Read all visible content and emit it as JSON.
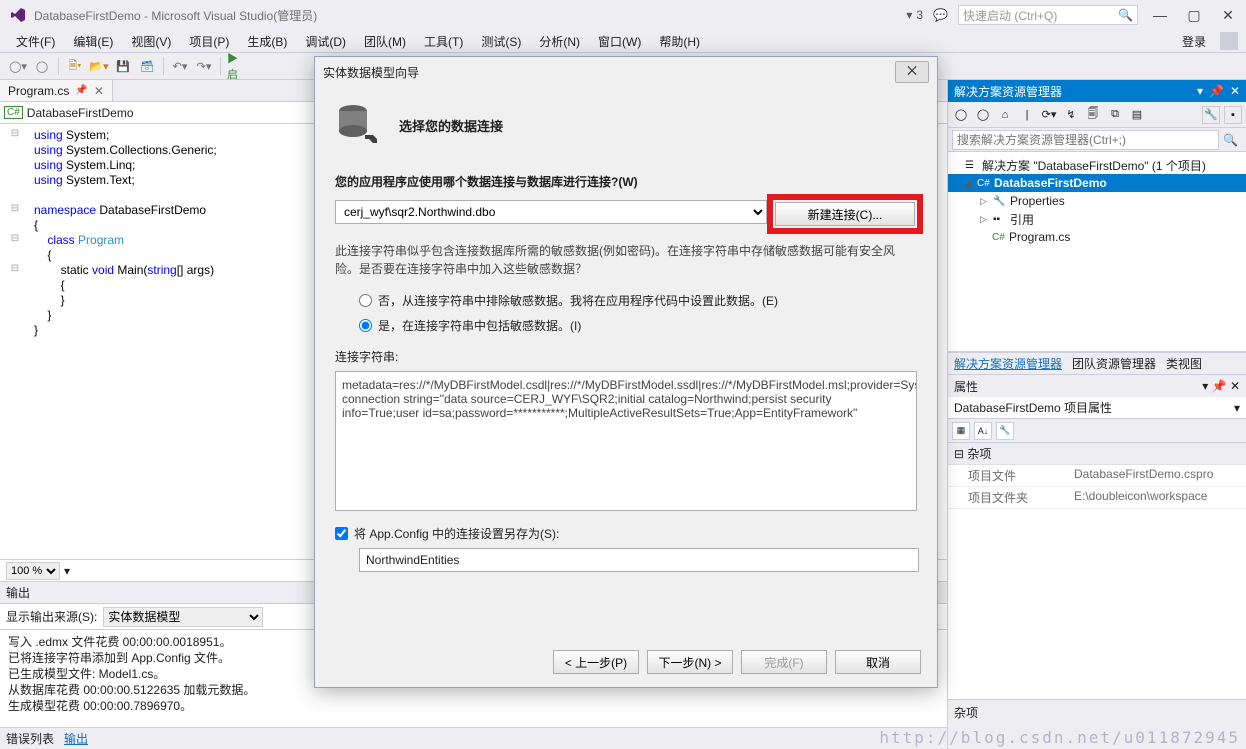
{
  "titlebar": {
    "title": "DatabaseFirstDemo - Microsoft Visual Studio(管理员)",
    "notif_count": "3",
    "search_placeholder": "快速启动 (Ctrl+Q)"
  },
  "menu": {
    "items": [
      "文件(F)",
      "编辑(E)",
      "视图(V)",
      "项目(P)",
      "生成(B)",
      "调试(D)",
      "团队(M)",
      "工具(T)",
      "测试(S)",
      "分析(N)",
      "窗口(W)",
      "帮助(H)"
    ],
    "login": "登录"
  },
  "doc_tab": {
    "name": "Program.cs"
  },
  "crumb": {
    "ns": "DatabaseFirstDemo"
  },
  "code": {
    "l1a": "using",
    "l1b": " System;",
    "l2a": "using",
    "l2b": " System.Collections.Generic;",
    "l3a": "using",
    "l3b": " System.Linq;",
    "l4a": "using",
    "l4b": " System.Text;",
    "l5a": "namespace",
    "l5b": " DatabaseFirstDemo",
    "l6": "{",
    "l7a": "    class",
    "l7b": " Program",
    "l8": "    {",
    "l9a": "        static ",
    "l9b": "void",
    "l9c": " Main(",
    "l9d": "string",
    "l9e": "[] args)",
    "l10": "        {",
    "l11": "        }",
    "l12": "    }",
    "l13": "}"
  },
  "zoom": "100 %",
  "output": {
    "title": "输出",
    "src_label": "显示输出来源(S):",
    "src_value": "实体数据模型",
    "lines": [
      "写入 .edmx 文件花费 00:00:00.0018951。",
      "已将连接字符串添加到 App.Config 文件。",
      "已生成模型文件: Model1.cs。",
      "从数据库花费 00:00:00.5122635 加载元数据。",
      "生成模型花费 00:00:00.7896970。"
    ],
    "tabs": [
      "错误列表",
      "输出"
    ]
  },
  "se": {
    "title": "解决方案资源管理器",
    "search_ph": "搜索解决方案资源管理器(Ctrl+;)",
    "sol": "解决方案 \"DatabaseFirstDemo\" (1 个项目)",
    "proj": "DatabaseFirstDemo",
    "nodes": [
      "Properties",
      "引用",
      "Program.cs"
    ],
    "bot_tabs": [
      "解决方案资源管理器",
      "团队资源管理器",
      "类视图"
    ]
  },
  "props": {
    "title": "属性",
    "obj": "DatabaseFirstDemo 项目属性",
    "cat": "杂项",
    "rows": [
      {
        "k": "项目文件",
        "v": "DatabaseFirstDemo.cspro"
      },
      {
        "k": "项目文件夹",
        "v": "E:\\doubleicon\\workspace"
      }
    ],
    "desc": "杂项"
  },
  "dialog": {
    "title": "实体数据模型向导",
    "heading": "选择您的数据连接",
    "q": "您的应用程序应使用哪个数据连接与数据库进行连接?(W)",
    "conn": "cerj_wyf\\sqr2.Northwind.dbo",
    "new_conn": "新建连接(C)...",
    "sensitive": "此连接字符串似乎包含连接数据库所需的敏感数据(例如密码)。在连接字符串中存储敏感数据可能有安全风险。是否要在连接字符串中加入这些敏感数据？",
    "r_no": "否，从连接字符串中排除敏感数据。我将在应用程序代码中设置此数据。(E)",
    "r_yes": "是，在连接字符串中包括敏感数据。(I)",
    "cs_label": "连接字符串:",
    "cs": "metadata=res://*/MyDBFirstModel.csdl|res://*/MyDBFirstModel.ssdl|res://*/MyDBFirstModel.msl;provider=System.Data.SqlClient;provider connection string=\"data source=CERJ_WYF\\SQR2;initial catalog=Northwind;persist security info=True;user id=sa;password=***********;MultipleActiveResultSets=True;App=EntityFramework\"",
    "save_chk": "将 App.Config 中的连接设置另存为(S):",
    "save_name": "NorthwindEntities",
    "btn_prev": "< 上一步(P)",
    "btn_next": "下一步(N) >",
    "btn_finish": "完成(F)",
    "btn_cancel": "取消"
  },
  "watermark": "http://blog.csdn.net/u011872945"
}
